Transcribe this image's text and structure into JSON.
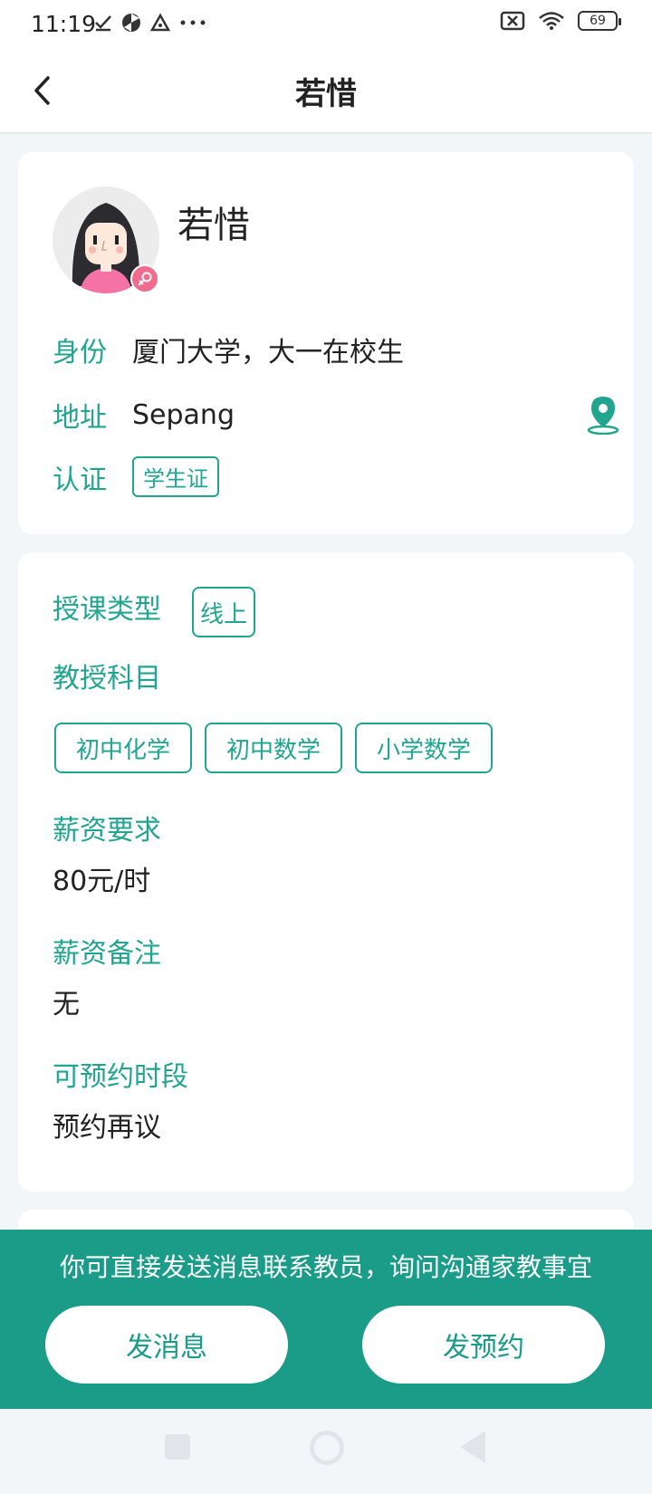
{
  "status_bar": {
    "time": "11:19",
    "battery": "69"
  },
  "header": {
    "title": "若惜"
  },
  "profile": {
    "name": "若惜",
    "identity_label": "身份",
    "identity_value": "厦门大学，大一在校生",
    "address_label": "地址",
    "address_value": "Sepang",
    "cert_label": "认证",
    "cert_tag": "学生证"
  },
  "details": {
    "teaching_type_label": "授课类型",
    "teaching_type_tag": "线上",
    "subjects_label": "教授科目",
    "subjects": [
      "初中化学",
      "初中数学",
      "小学数学"
    ],
    "salary_label": "薪资要求",
    "salary_value": "80元/时",
    "salary_note_label": "薪资备注",
    "salary_note_value": "无",
    "available_time_label": "可预约时段",
    "available_time_value": "预约再议"
  },
  "action_bar": {
    "hint": "你可直接发送消息联系教员，询问沟通家教事宜",
    "message_button": "发消息",
    "booking_button": "发预约"
  },
  "colors": {
    "accent": "#21a58f",
    "action_bar_bg": "#1a9c89",
    "gender_badge": "#f06b8d"
  }
}
